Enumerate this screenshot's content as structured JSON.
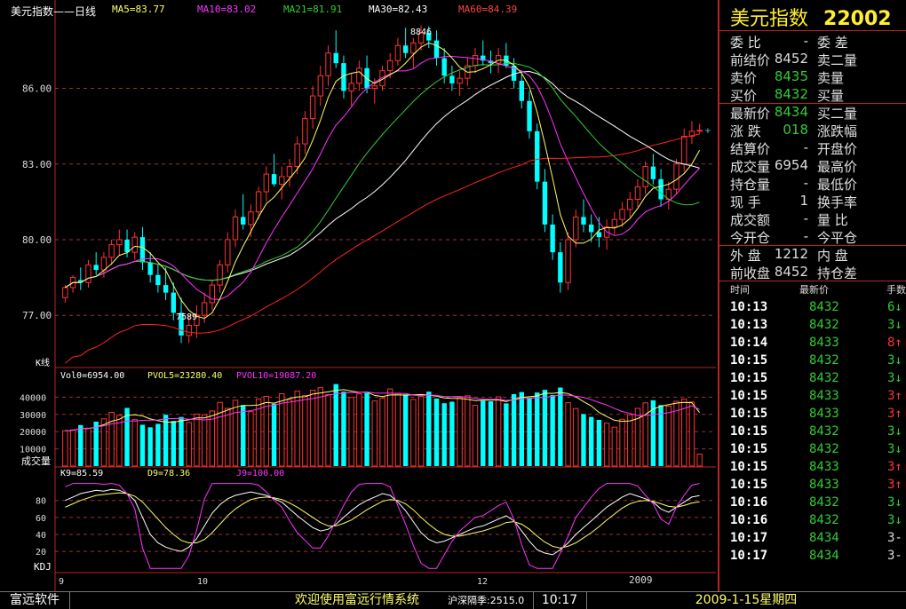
{
  "header": {
    "title": "美元指数——日线",
    "ma5": "MA5=83.77",
    "ma10": "MA10=83.02",
    "ma21": "MA21=81.91",
    "ma30": "MA30=82.43",
    "ma60": "MA60=84.39"
  },
  "annotations": {
    "high": "8846",
    "low": "7589",
    "kline": "K线"
  },
  "volume_panel": {
    "vol": "Vol0=6954.00",
    "pvol5": "PVOL5=23280.40",
    "pvol10": "PVOL10=19087.20",
    "label": "成交量"
  },
  "kdj_panel": {
    "k": "K9=85.59",
    "d": "D9=78.36",
    "j": "J9=100.00",
    "label": "KDJ"
  },
  "x_axis": {
    "labels": [
      "9",
      "10",
      "12",
      "2009"
    ]
  },
  "quote": {
    "name": "美元指数",
    "code": "22002",
    "rows": [
      {
        "l": "委 比",
        "v": "-",
        "r": "委 差",
        "vc": "#ddd"
      },
      {
        "l": "前结价",
        "v": "8452",
        "r": "卖二量",
        "vc": "#ddd"
      },
      {
        "l": "卖价",
        "v": "8435",
        "r": "卖量",
        "vc": "#3c3"
      },
      {
        "l": "买价",
        "v": "8432",
        "r": "买量",
        "vc": "#3c3"
      },
      {
        "l": "最新价",
        "v": "8434",
        "r": "买二量",
        "vc": "#3c3"
      },
      {
        "l": "涨 跌",
        "v": "018",
        "r": "涨跌幅",
        "vc": "#3c3"
      },
      {
        "l": "结算价",
        "v": "-",
        "r": "开盘价",
        "vc": "#ddd"
      },
      {
        "l": "成交量",
        "v": "6954",
        "r": "最高价",
        "vc": "#ddd"
      },
      {
        "l": "持仓量",
        "v": "-",
        "r": "最低价",
        "vc": "#ddd"
      },
      {
        "l": "现 手",
        "v": "1",
        "r": "换手率",
        "vc": "#ddd"
      },
      {
        "l": "成交额",
        "v": "-",
        "r": "量 比",
        "vc": "#ddd"
      },
      {
        "l": "今开仓",
        "v": "-",
        "r": "今平仓",
        "vc": "#ddd"
      },
      {
        "l": "外 盘",
        "v": "1212",
        "r": "内 盘",
        "vc": "#ddd"
      },
      {
        "l": "前收盘",
        "v": "8452",
        "r": "持仓差",
        "vc": "#ddd"
      }
    ]
  },
  "ticks": {
    "headers": [
      "时间",
      "最新价",
      "手数"
    ],
    "rows": [
      {
        "t": "10:13",
        "p": "8432",
        "v": "6↓",
        "c": "#3c3"
      },
      {
        "t": "10:13",
        "p": "8432",
        "v": "3↓",
        "c": "#3c3"
      },
      {
        "t": "10:14",
        "p": "8433",
        "v": "8↑",
        "c": "#f33"
      },
      {
        "t": "10:15",
        "p": "8432",
        "v": "3↓",
        "c": "#3c3"
      },
      {
        "t": "10:15",
        "p": "8432",
        "v": "3↓",
        "c": "#3c3"
      },
      {
        "t": "10:15",
        "p": "8433",
        "v": "3↑",
        "c": "#f33"
      },
      {
        "t": "10:15",
        "p": "8433",
        "v": "3↑",
        "c": "#f33"
      },
      {
        "t": "10:15",
        "p": "8432",
        "v": "3↓",
        "c": "#3c3"
      },
      {
        "t": "10:15",
        "p": "8432",
        "v": "3↓",
        "c": "#3c3"
      },
      {
        "t": "10:15",
        "p": "8433",
        "v": "3↑",
        "c": "#f33"
      },
      {
        "t": "10:15",
        "p": "8433",
        "v": "3↑",
        "c": "#f33"
      },
      {
        "t": "10:16",
        "p": "8432",
        "v": "3↓",
        "c": "#3c3"
      },
      {
        "t": "10:16",
        "p": "8432",
        "v": "3↓",
        "c": "#3c3"
      },
      {
        "t": "10:17",
        "p": "8434",
        "v": "3-",
        "c": "#ddd"
      },
      {
        "t": "10:17",
        "p": "8434",
        "v": "3-",
        "c": "#ddd"
      }
    ]
  },
  "status": {
    "brand": "富远软件",
    "welcome": "欢迎使用富远行情系统",
    "index": "沪深隔季:2515.0",
    "time": "10:17",
    "date": "2009-1-15星期四"
  },
  "colors": {
    "up": "#ff3333",
    "down": "#00ffff",
    "ma5": "#ffff66",
    "ma10": "#ff33ff",
    "ma21": "#33cc33",
    "ma30": "#ffffff",
    "ma60": "#ff2222",
    "grid": "#993333"
  },
  "chart_data": {
    "type": "candlestick",
    "ylim": [
      75.0,
      88.8
    ],
    "yticks": [
      77.0,
      80.0,
      83.0,
      86.0
    ],
    "candles": [
      [
        77.7,
        78.2,
        77.5,
        78.1
      ],
      [
        78.1,
        78.6,
        77.9,
        78.5
      ],
      [
        78.4,
        78.9,
        78.0,
        78.3
      ],
      [
        78.3,
        79.2,
        78.1,
        79.0
      ],
      [
        79.0,
        79.5,
        78.6,
        78.8
      ],
      [
        78.8,
        79.5,
        78.5,
        79.3
      ],
      [
        79.3,
        80.0,
        79.0,
        79.8
      ],
      [
        79.8,
        80.4,
        79.4,
        80.0
      ],
      [
        80.0,
        80.4,
        79.3,
        79.5
      ],
      [
        79.5,
        80.3,
        79.2,
        80.1
      ],
      [
        80.1,
        80.5,
        78.8,
        79.1
      ],
      [
        79.1,
        79.5,
        78.3,
        78.6
      ],
      [
        78.6,
        79.0,
        77.9,
        78.2
      ],
      [
        78.2,
        78.9,
        77.6,
        77.9
      ],
      [
        77.9,
        78.3,
        76.8,
        77.1
      ],
      [
        77.1,
        77.7,
        75.9,
        76.2
      ],
      [
        76.2,
        77.0,
        75.9,
        76.6
      ],
      [
        76.6,
        77.4,
        76.1,
        77.0
      ],
      [
        77.0,
        77.9,
        76.7,
        77.5
      ],
      [
        77.5,
        78.4,
        77.2,
        78.2
      ],
      [
        78.2,
        79.2,
        77.9,
        79.0
      ],
      [
        79.0,
        80.3,
        78.7,
        80.0
      ],
      [
        80.0,
        81.2,
        79.7,
        80.9
      ],
      [
        80.9,
        81.8,
        80.4,
        80.6
      ],
      [
        80.6,
        81.4,
        80.1,
        81.1
      ],
      [
        81.1,
        82.1,
        80.8,
        81.9
      ],
      [
        81.9,
        82.9,
        81.5,
        82.6
      ],
      [
        82.6,
        83.4,
        82.1,
        82.2
      ],
      [
        82.2,
        82.9,
        81.6,
        82.5
      ],
      [
        82.5,
        83.2,
        82.1,
        82.9
      ],
      [
        82.9,
        84.1,
        82.6,
        83.8
      ],
      [
        83.8,
        85.1,
        83.4,
        84.8
      ],
      [
        84.8,
        86.1,
        84.4,
        85.7
      ],
      [
        85.7,
        86.9,
        85.3,
        86.5
      ],
      [
        86.5,
        87.7,
        86.1,
        87.4
      ],
      [
        87.4,
        88.3,
        86.8,
        87.0
      ],
      [
        87.0,
        87.3,
        85.6,
        85.9
      ],
      [
        85.9,
        86.6,
        85.3,
        86.2
      ],
      [
        86.2,
        87.1,
        85.9,
        86.8
      ],
      [
        86.8,
        87.3,
        85.8,
        86.0
      ],
      [
        86.0,
        86.4,
        85.4,
        86.1
      ],
      [
        86.1,
        86.9,
        85.9,
        86.7
      ],
      [
        86.7,
        87.4,
        86.4,
        87.1
      ],
      [
        87.1,
        88.0,
        86.9,
        87.7
      ],
      [
        87.7,
        88.4,
        87.2,
        87.4
      ],
      [
        87.4,
        88.0,
        86.8,
        87.8
      ],
      [
        87.8,
        88.5,
        87.5,
        88.2
      ],
      [
        88.2,
        88.46,
        87.6,
        87.9
      ],
      [
        87.9,
        88.3,
        86.9,
        87.2
      ],
      [
        87.2,
        87.6,
        86.2,
        86.5
      ],
      [
        86.5,
        86.9,
        85.9,
        86.2
      ],
      [
        86.2,
        86.7,
        85.7,
        86.4
      ],
      [
        86.4,
        87.2,
        86.1,
        86.9
      ],
      [
        86.9,
        87.6,
        86.6,
        87.3
      ],
      [
        87.3,
        87.9,
        86.9,
        87.1
      ],
      [
        87.1,
        87.5,
        86.6,
        87.0
      ],
      [
        87.0,
        87.6,
        86.6,
        87.3
      ],
      [
        87.3,
        87.8,
        86.8,
        86.9
      ],
      [
        86.9,
        87.2,
        86.0,
        86.3
      ],
      [
        86.3,
        86.6,
        85.2,
        85.5
      ],
      [
        85.5,
        85.9,
        84.0,
        84.3
      ],
      [
        84.3,
        84.6,
        82.0,
        82.3
      ],
      [
        82.3,
        82.8,
        80.3,
        80.6
      ],
      [
        80.6,
        81.0,
        79.2,
        79.5
      ],
      [
        79.5,
        79.9,
        77.9,
        78.3
      ],
      [
        78.3,
        80.3,
        78.0,
        80.0
      ],
      [
        80.0,
        81.2,
        79.7,
        80.9
      ],
      [
        80.9,
        81.6,
        80.3,
        80.6
      ],
      [
        80.6,
        81.0,
        79.9,
        80.3
      ],
      [
        80.3,
        80.9,
        79.7,
        80.1
      ],
      [
        80.1,
        80.8,
        79.6,
        80.5
      ],
      [
        80.5,
        81.1,
        80.2,
        80.8
      ],
      [
        80.8,
        81.5,
        80.5,
        81.2
      ],
      [
        81.2,
        81.9,
        80.9,
        81.6
      ],
      [
        81.6,
        82.4,
        81.3,
        82.1
      ],
      [
        82.1,
        83.1,
        81.8,
        82.9
      ],
      [
        82.9,
        83.4,
        82.2,
        82.4
      ],
      [
        82.4,
        82.8,
        81.3,
        81.6
      ],
      [
        81.6,
        82.3,
        81.2,
        82.0
      ],
      [
        82.0,
        83.2,
        81.8,
        83.0
      ],
      [
        83.0,
        84.4,
        82.7,
        84.1
      ],
      [
        84.1,
        84.7,
        83.8,
        84.3
      ],
      [
        84.3,
        84.6,
        84.2,
        84.34
      ]
    ],
    "volumes": [
      20500,
      21000,
      23800,
      22000,
      25800,
      27400,
      31200,
      29500,
      33800,
      27000,
      24000,
      22500,
      24500,
      29800,
      26200,
      28500,
      25300,
      30200,
      29800,
      32000,
      37000,
      33500,
      38200,
      35400,
      31600,
      39000,
      40500,
      36200,
      42000,
      38500,
      43500,
      41000,
      44000,
      45500,
      41500,
      47600,
      43200,
      39800,
      41900,
      42500,
      37800,
      39500,
      44800,
      42300,
      41600,
      38700,
      40400,
      43200,
      39200,
      36500,
      37400,
      39900,
      40800,
      35300,
      38000,
      37600,
      40200,
      36400,
      41800,
      43000,
      39800,
      42700,
      44300,
      41200,
      45600,
      36800,
      33400,
      30200,
      28500,
      26800,
      24900,
      22600,
      27200,
      29800,
      33500,
      36700,
      38200,
      35400,
      34800,
      37600,
      38900,
      37200,
      6954
    ],
    "kdj_k": [
      80,
      84,
      88,
      90,
      92,
      91,
      93,
      92,
      88,
      80,
      60,
      40,
      30,
      25,
      22,
      20,
      25,
      35,
      50,
      65,
      75,
      82,
      86,
      88,
      90,
      88,
      86,
      82,
      78,
      70,
      62,
      55,
      48,
      44,
      46,
      52,
      60,
      68,
      75,
      80,
      84,
      88,
      86,
      78,
      68,
      55,
      42,
      34,
      30,
      32,
      36,
      40,
      44,
      48,
      50,
      54,
      58,
      62,
      56,
      44,
      32,
      22,
      18,
      16,
      22,
      30,
      40,
      48,
      56,
      64,
      72,
      78,
      84,
      88,
      85,
      82,
      78,
      70,
      66,
      72,
      78,
      84,
      85.59
    ],
    "kdj_d": [
      72,
      76,
      80,
      83,
      86,
      87,
      88,
      89,
      88,
      85,
      78,
      68,
      58,
      48,
      40,
      33,
      30,
      30,
      34,
      42,
      52,
      62,
      70,
      76,
      81,
      83,
      84,
      83,
      81,
      77,
      72,
      66,
      60,
      54,
      50,
      50,
      53,
      57,
      63,
      69,
      74,
      79,
      81,
      80,
      76,
      69,
      60,
      52,
      45,
      40,
      38,
      38,
      40,
      42,
      44,
      47,
      50,
      54,
      55,
      52,
      46,
      38,
      31,
      26,
      24,
      26,
      30,
      36,
      42,
      49,
      57,
      64,
      71,
      76,
      79,
      80,
      79,
      76,
      73,
      72,
      74,
      77,
      78.36
    ],
    "kdj_j": [
      96,
      100,
      100,
      100,
      100,
      99,
      100,
      98,
      88,
      70,
      24,
      0,
      0,
      0,
      0,
      0,
      15,
      45,
      82,
      100,
      100,
      100,
      100,
      100,
      100,
      98,
      90,
      80,
      72,
      56,
      42,
      33,
      24,
      24,
      38,
      56,
      74,
      90,
      99,
      100,
      100,
      100,
      96,
      74,
      52,
      27,
      6,
      0,
      0,
      16,
      32,
      44,
      52,
      60,
      62,
      68,
      74,
      78,
      58,
      28,
      4,
      0,
      0,
      0,
      18,
      38,
      60,
      72,
      84,
      94,
      100,
      100,
      100,
      100,
      97,
      86,
      76,
      58,
      52,
      72,
      86,
      98,
      100
    ]
  }
}
